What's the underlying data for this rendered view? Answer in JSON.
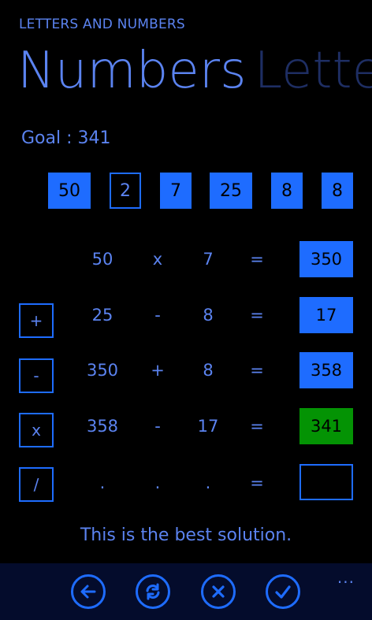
{
  "app": {
    "title": "LETTERS AND NUMBERS"
  },
  "pivot": {
    "active": "Numbers",
    "inactive": "Lette"
  },
  "goal": {
    "text": "Goal : 341"
  },
  "tiles": [
    "50",
    "2",
    "7",
    "25",
    "8",
    "8"
  ],
  "operators": {
    "plus": "+",
    "minus": "-",
    "times": "x",
    "divide": "/"
  },
  "rows": [
    {
      "a": "50",
      "op": "x",
      "b": "7",
      "eq": "=",
      "result": "350"
    },
    {
      "a": "25",
      "op": "-",
      "b": "8",
      "eq": "=",
      "result": "17"
    },
    {
      "a": "350",
      "op": "+",
      "b": "8",
      "eq": "=",
      "result": "358"
    },
    {
      "a": "358",
      "op": "-",
      "b": "17",
      "eq": "=",
      "result": "341"
    },
    {
      "a": ".",
      "op": ".",
      "b": ".",
      "eq": "=",
      "result": ""
    }
  ],
  "message": "This is the best solution.",
  "appbar": {
    "buttons": [
      "back-arrow-icon",
      "refresh-icon",
      "close-icon",
      "checkmark-icon"
    ],
    "more": "..."
  },
  "colors": {
    "accent": "#1e6cff",
    "text": "#5b83f0",
    "success": "#049304",
    "appbar": "#040c2c"
  }
}
